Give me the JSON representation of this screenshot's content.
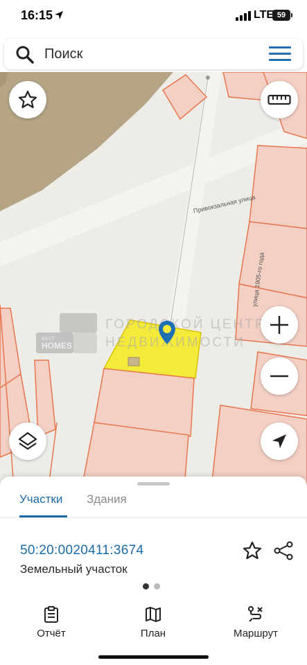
{
  "status_bar": {
    "time": "16:15",
    "network": "LTE",
    "battery": "59"
  },
  "search": {
    "placeholder": "Поиск"
  },
  "map": {
    "streets": [
      "Привокзальная улица",
      "улица 1905-го года"
    ],
    "watermark": {
      "logo_line1": "BEST",
      "logo_line2": "HOMES",
      "line1": "ГОРОДСКОЙ ЦЕНТР",
      "line2": "НЕДВИЖИМОСТИ"
    },
    "colors": {
      "background": "#eeece6",
      "parcel_fill": "#f3cfc4",
      "parcel_stroke": "#e8764f",
      "selected_fill": "#f3ea3a",
      "pin": "#1f6fb2"
    },
    "controls": [
      "star-icon",
      "ruler-icon",
      "layers-icon",
      "zoom-in-icon",
      "zoom-out-icon",
      "navigation-icon"
    ]
  },
  "sheet": {
    "tabs": [
      {
        "label": "Участки",
        "active": true
      },
      {
        "label": "Здания",
        "active": false
      }
    ],
    "parcel": {
      "cadastral_number": "50:20:0020411:3674",
      "type": "Земельный участок"
    },
    "pager": {
      "pages": 2,
      "current": 1
    }
  },
  "bottom_nav": {
    "items": [
      {
        "label": "Отчёт",
        "icon": "clipboard-icon"
      },
      {
        "label": "План",
        "icon": "map-icon"
      },
      {
        "label": "Маршрут",
        "icon": "route-icon"
      }
    ]
  }
}
